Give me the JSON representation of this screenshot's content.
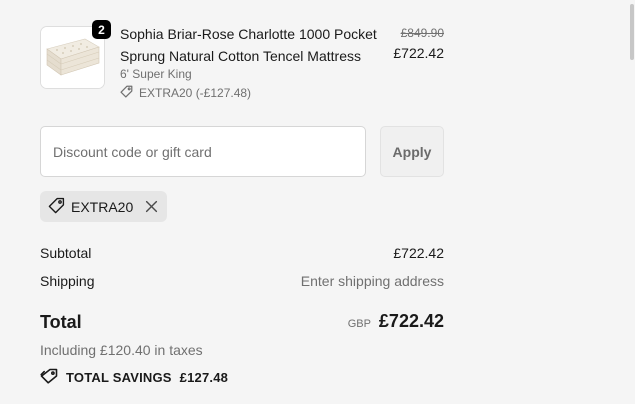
{
  "line_item": {
    "quantity": "2",
    "title": "Sophia Briar-Rose Charlotte 1000 Pocket Sprung Natural Cotton Tencel Mattress",
    "variant": "6' Super King",
    "discount_label": "EXTRA20 (-£127.48)",
    "compare_price": "£849.90",
    "price": "£722.42",
    "image_icon": "mattress-image"
  },
  "discount_form": {
    "placeholder": "Discount code or gift card",
    "value": "",
    "apply_label": "Apply"
  },
  "applied_code": {
    "code": "EXTRA20"
  },
  "summary": {
    "subtotal_label": "Subtotal",
    "subtotal_value": "£722.42",
    "shipping_label": "Shipping",
    "shipping_value": "Enter shipping address",
    "total_label": "Total",
    "currency": "GBP",
    "total_value": "£722.42",
    "taxes_note": "Including £120.40 in taxes",
    "savings_label": "TOTAL SAVINGS",
    "savings_value": "£127.48"
  }
}
